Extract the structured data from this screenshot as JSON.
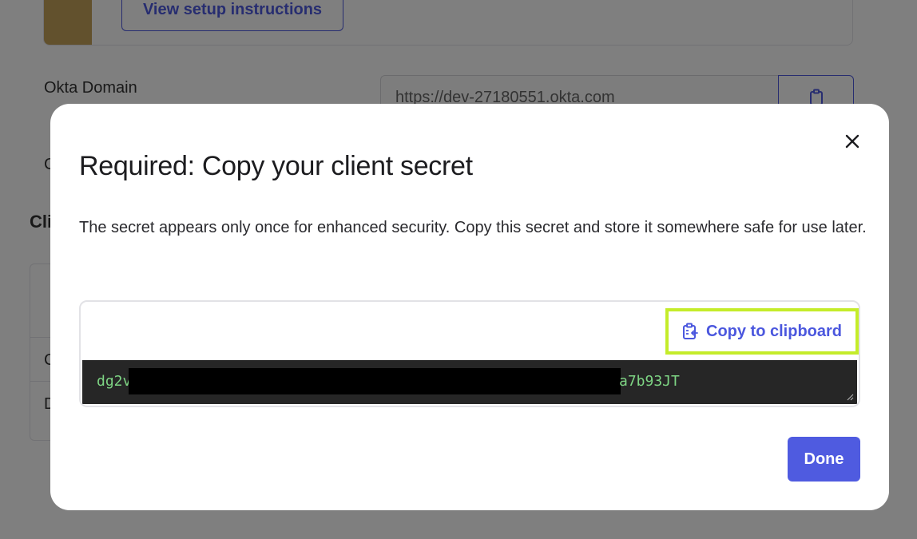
{
  "background": {
    "setup_button_label": "View setup instructions",
    "okta_domain_label": "Okta Domain",
    "okta_domain_value": "https://dev-27180551.okta.com",
    "partial_label_1": "C",
    "partial_heading": "Cli",
    "partial_row_1": "C",
    "partial_row_2": "D",
    "copy_icon": "clipboard-icon"
  },
  "modal": {
    "title": "Required: Copy your client secret",
    "description": "The secret appears only once for enhanced security. Copy this secret and store it somewhere safe for use later.",
    "copy_button_label": "Copy to clipboard",
    "copy_icon": "clipboard-icon",
    "secret_visible_prefix": "dg2v",
    "secret_visible_suffix": "a7b93JT",
    "done_label": "Done",
    "close_icon": "close-icon"
  },
  "colors": {
    "accent": "#4f5be0",
    "highlight": "#c4ec2a",
    "secret_text": "#7ed584",
    "secret_bg": "#262626"
  }
}
